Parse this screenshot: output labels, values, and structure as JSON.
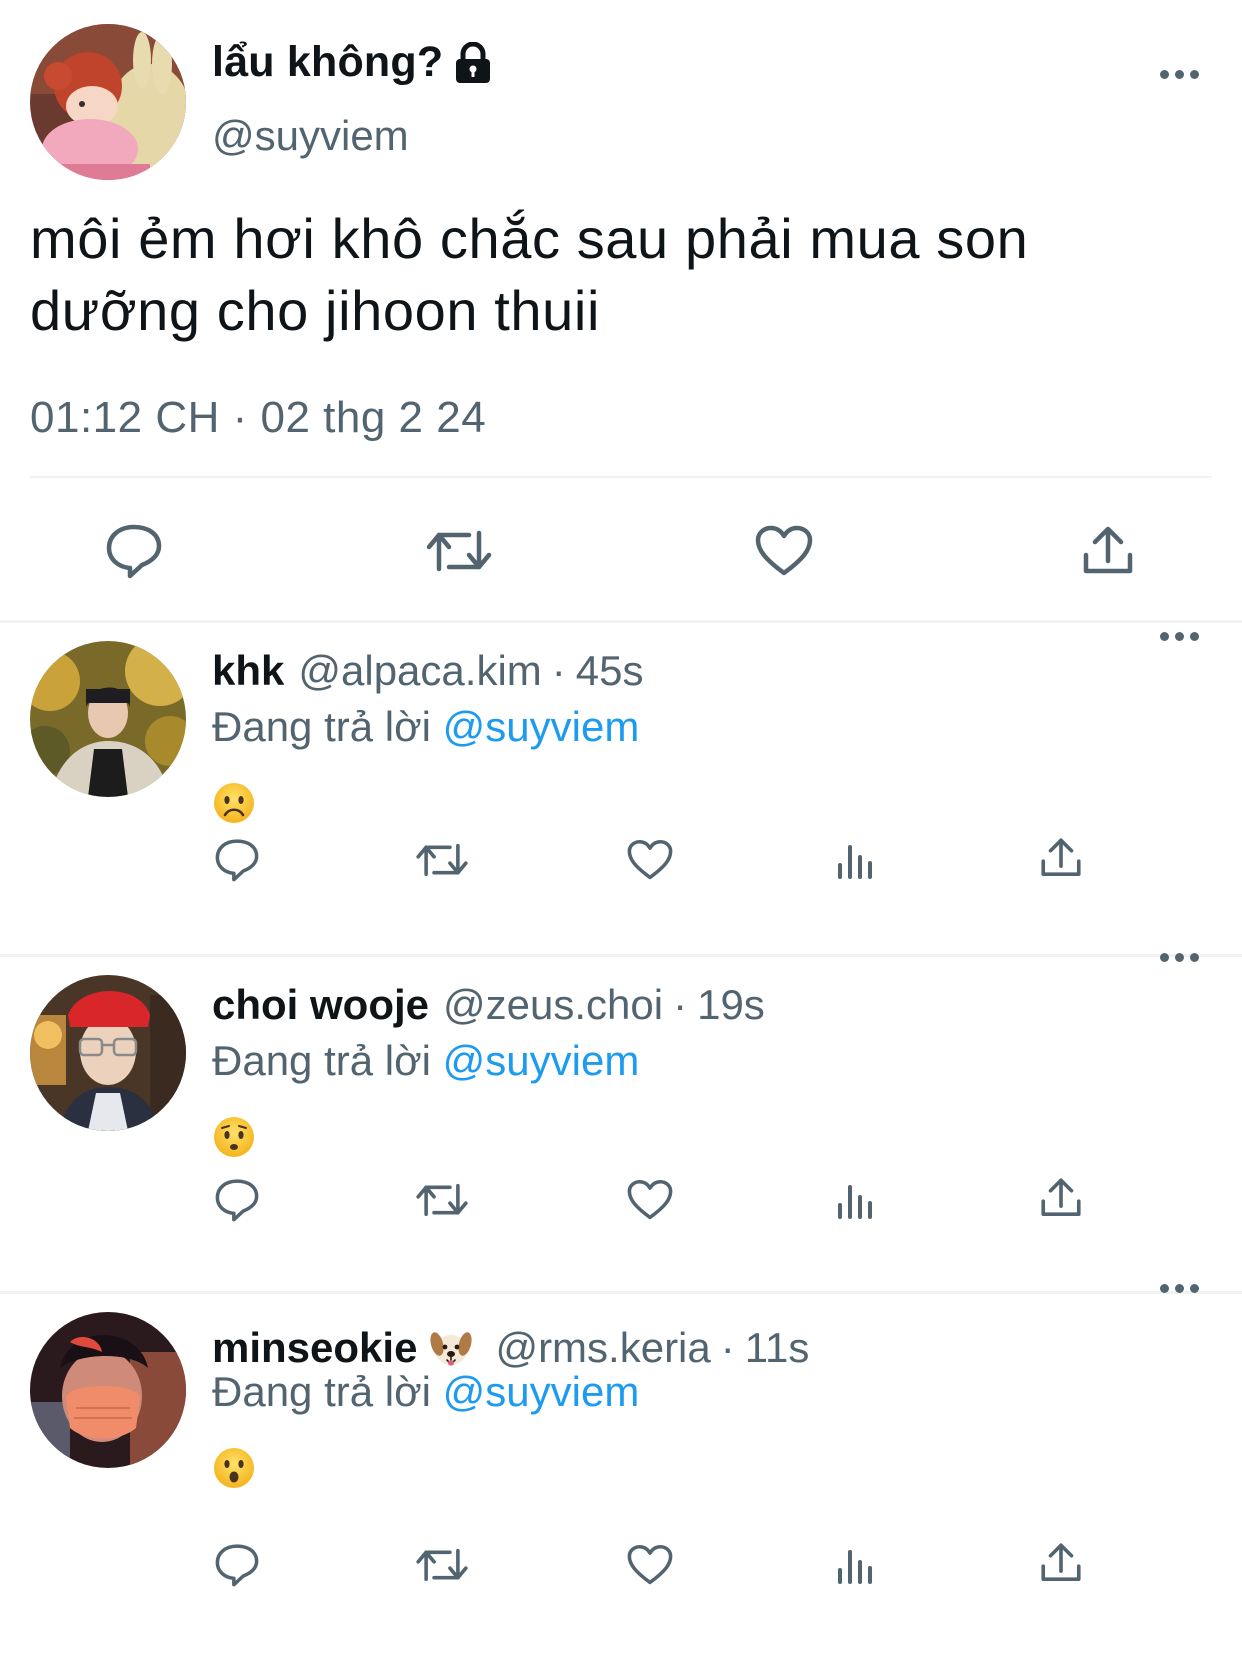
{
  "main_tweet": {
    "display_name": "lẩu không?",
    "handle": "@suyviem",
    "text": "môi ẻm hơi khô chắc sau phải mua son dưỡng cho jihoon thuii",
    "timestamp": "01:12 CH · 02 thg 2 24",
    "actions": [
      "reply-icon",
      "retweet-icon",
      "like-icon",
      "share-icon"
    ]
  },
  "replies": [
    {
      "display_name": "khk",
      "handle": "@alpaca.kim",
      "separator": "·",
      "time": "45s",
      "replying_prefix": "Đang trả lời",
      "replying_to": "@suyviem",
      "content_emoji": "worried-face-emoji",
      "actions": [
        "reply-icon",
        "retweet-icon",
        "like-icon",
        "views-icon",
        "share-icon"
      ]
    },
    {
      "display_name": "choi wooje",
      "handle": "@zeus.choi",
      "separator": "·",
      "time": "19s",
      "replying_prefix": "Đang trả lời",
      "replying_to": "@suyviem",
      "content_emoji": "hushed-face-emoji",
      "actions": [
        "reply-icon",
        "retweet-icon",
        "like-icon",
        "views-icon",
        "share-icon"
      ]
    },
    {
      "display_name": "minseokie",
      "name_badge": "dog-face-emoji",
      "handle": "@rms.keria",
      "separator": "·",
      "time": "11s",
      "replying_prefix": "Đang trả lời",
      "replying_to": "@suyviem",
      "content_emoji": "open-mouth-face-emoji",
      "actions": [
        "reply-icon",
        "retweet-icon",
        "like-icon",
        "views-icon",
        "share-icon"
      ]
    }
  ],
  "colors": {
    "primary_text": "#0f1419",
    "secondary_text": "#536471",
    "link": "#1d9bf0",
    "divider": "#eff3f4"
  }
}
